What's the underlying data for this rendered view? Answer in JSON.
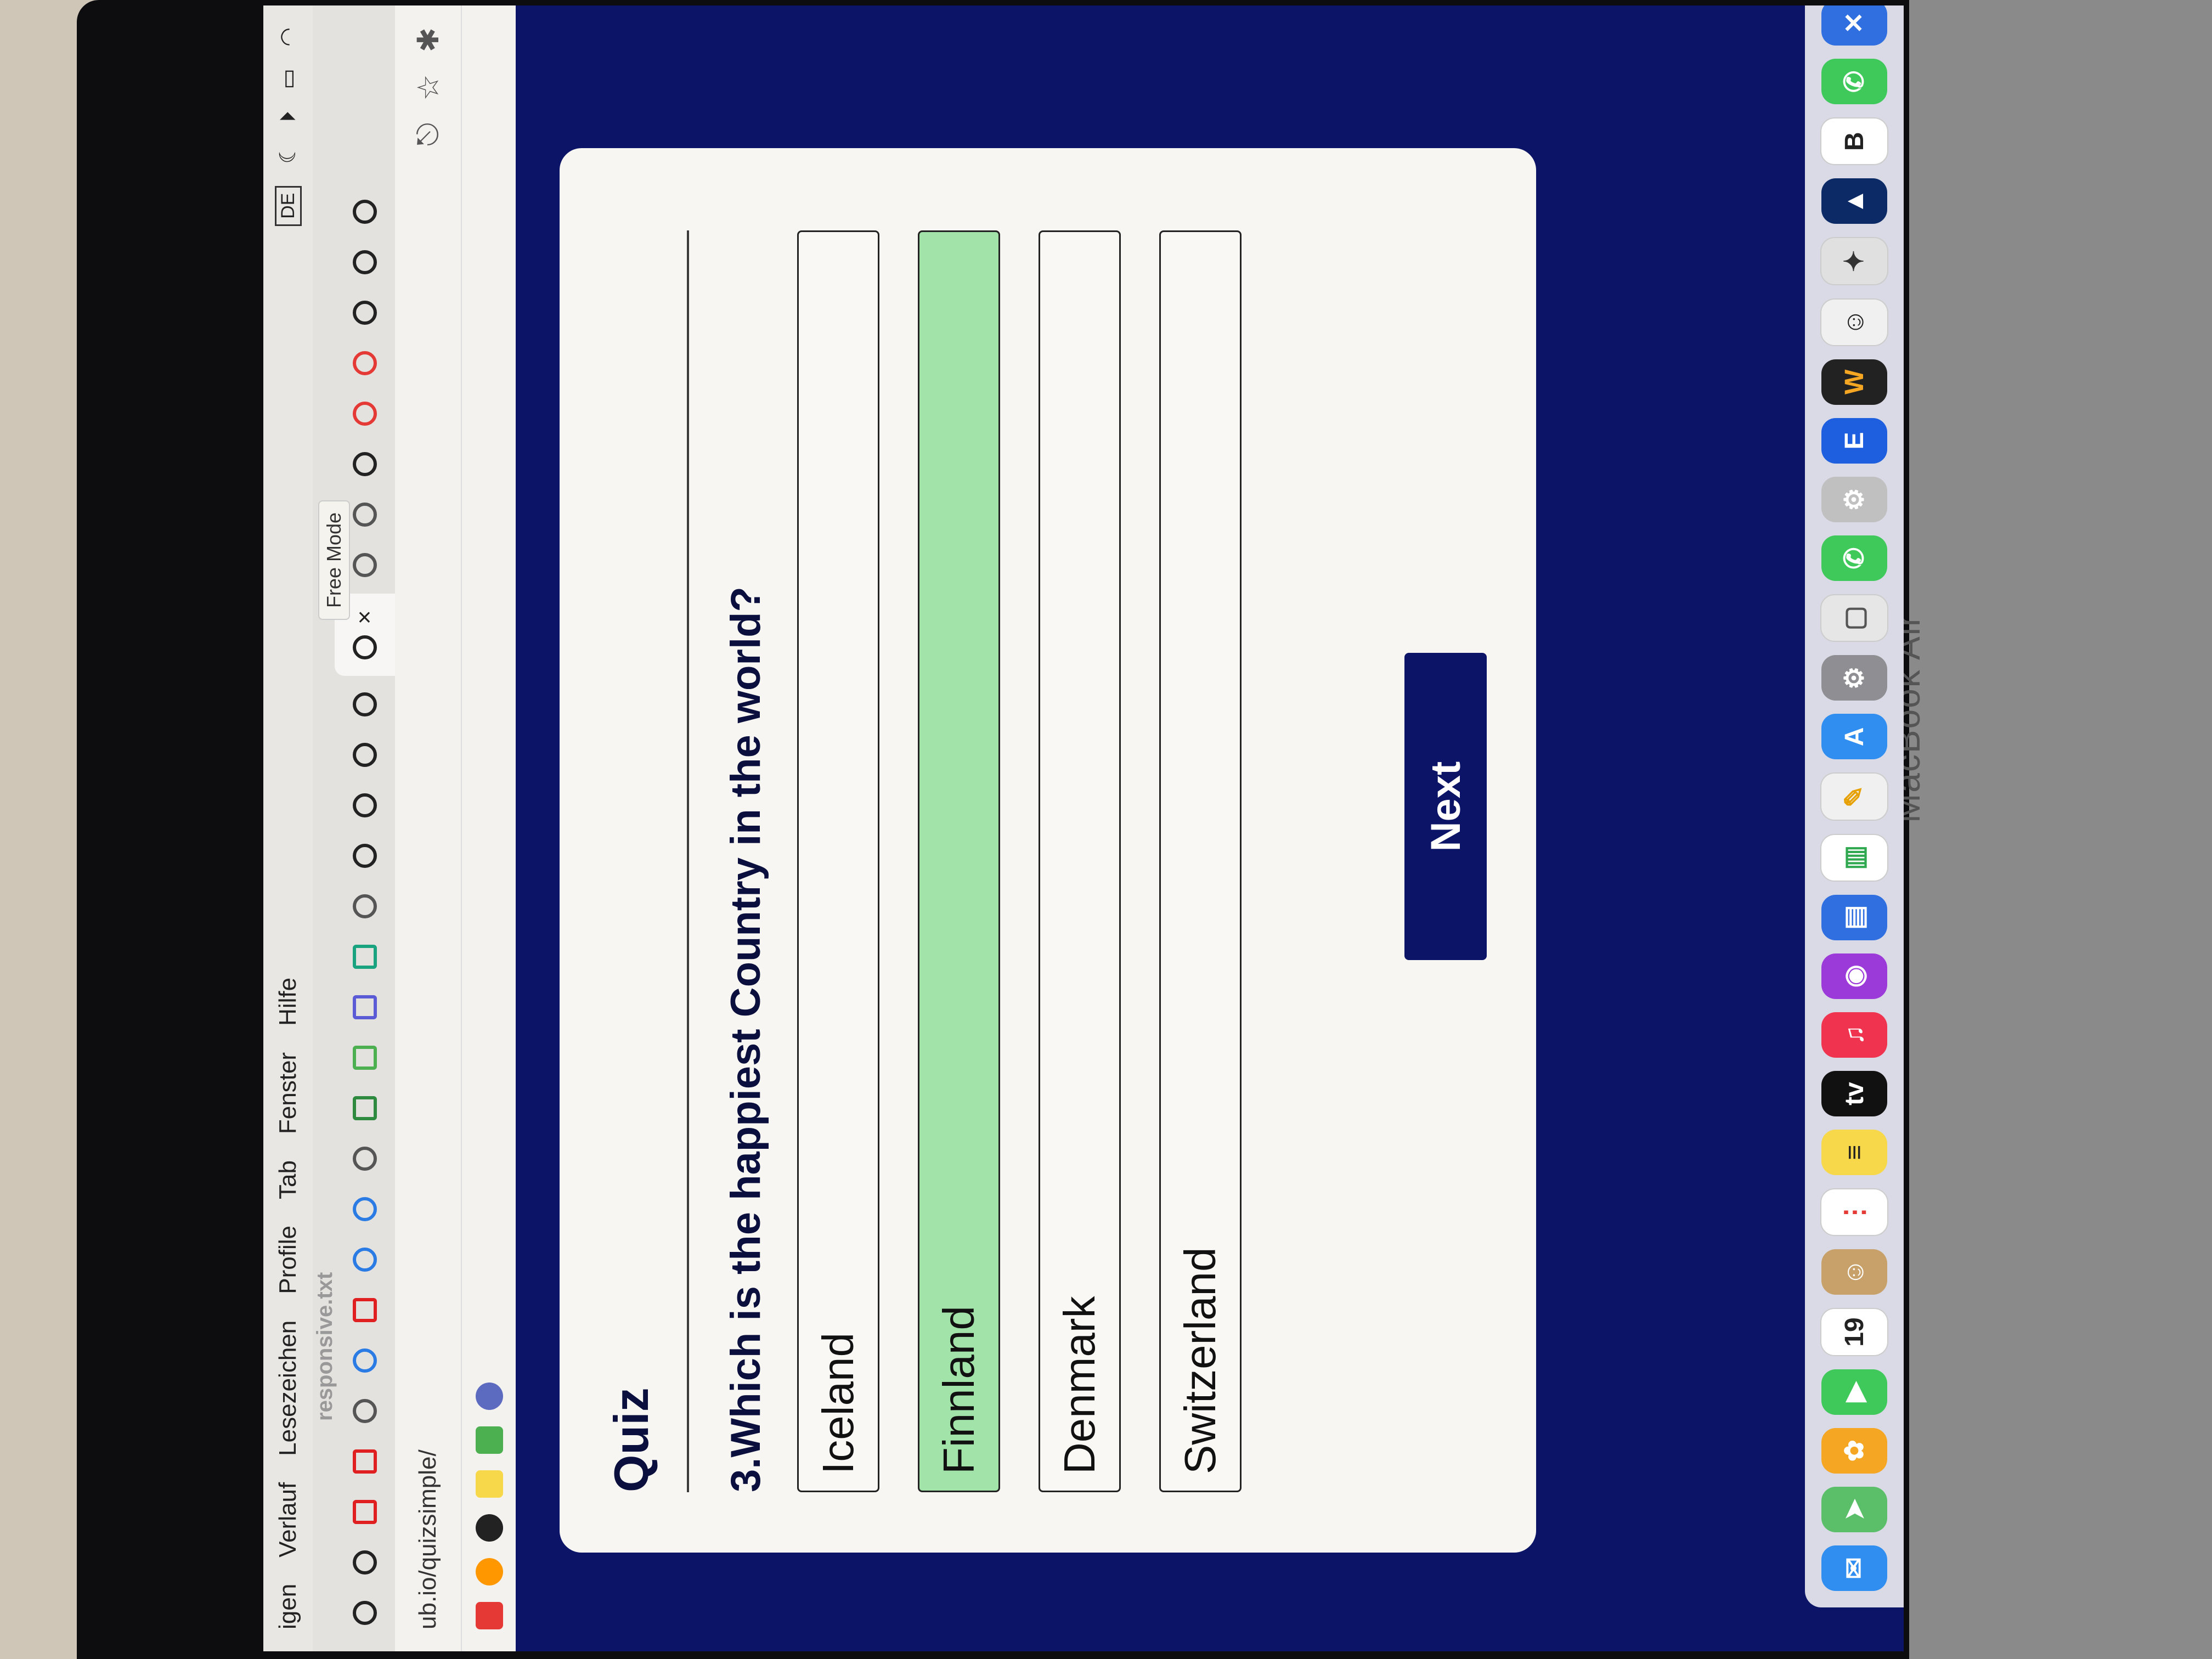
{
  "menubar": {
    "items": [
      "igen",
      "Verlauf",
      "Lesezeichen",
      "Profile",
      "Tab",
      "Fenster",
      "Hilfe"
    ],
    "input_source": "DE"
  },
  "browser": {
    "tab_ghost_title": "responsive.txt",
    "active_tab_close": "×",
    "free_mode_label": "Free Mode",
    "url": "ub.io/quizsimple/"
  },
  "quiz": {
    "title": "Quiz",
    "question": "3.Which is the happiest Country in the world?",
    "answers": [
      {
        "label": "Iceland",
        "state": "default"
      },
      {
        "label": "Finnland",
        "state": "correct"
      },
      {
        "label": "Denmark",
        "state": "default"
      },
      {
        "label": "Switzerland",
        "state": "default"
      }
    ],
    "next_label": "Next"
  },
  "dock": {
    "calendar_day": "19",
    "tv_label": "tv"
  },
  "hardware": {
    "brand": "MacBook Air"
  },
  "colors": {
    "page_background": "#0b1466",
    "correct_answer": "#a1e3a9",
    "button": "#0b1466"
  }
}
